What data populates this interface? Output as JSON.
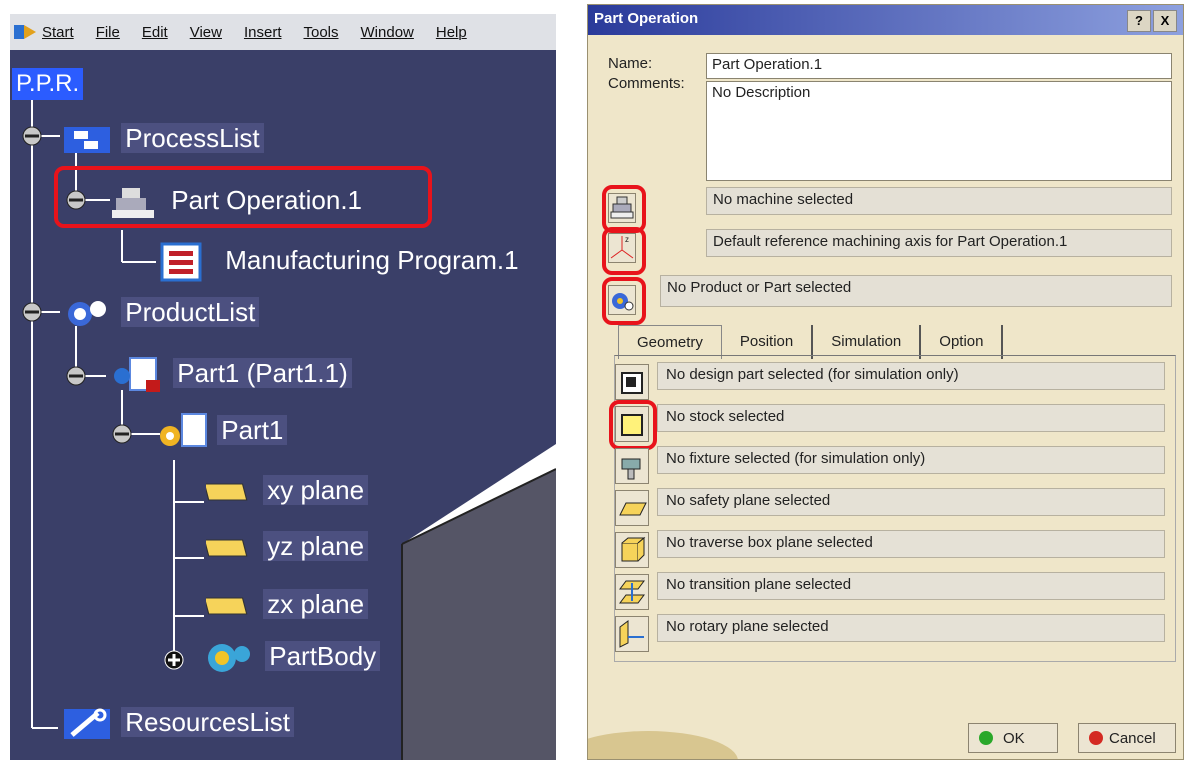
{
  "menubar": {
    "start": "Start",
    "items": [
      "File",
      "Edit",
      "View",
      "Insert",
      "Tools",
      "Window",
      "Help"
    ]
  },
  "tree": {
    "root": "P.P.R.",
    "process_list": "ProcessList",
    "part_operation": "Part Operation.1",
    "manufacturing_program": "Manufacturing Program.1",
    "product_list": "ProductList",
    "part1_instance": "Part1 (Part1.1)",
    "part1": "Part1",
    "xy_plane": "xy plane",
    "yz_plane": "yz plane",
    "zx_plane": "zx plane",
    "part_body": "PartBody",
    "resources_list": "ResourcesList"
  },
  "dialog": {
    "title": "Part Operation",
    "help_btn": "?",
    "close_btn": "X",
    "name_label": "Name:",
    "name_value": "Part Operation.1",
    "comments_label": "Comments:",
    "comments_value": "No Description",
    "machine": "No machine selected",
    "axis": "Default reference machining axis for Part Operation.1",
    "product": "No Product or Part selected",
    "tabs": [
      "Geometry",
      "Position",
      "Simulation",
      "Option"
    ],
    "geometry": [
      "No design part selected (for simulation only)",
      "No stock selected",
      "No fixture selected (for simulation only)",
      "No safety plane selected",
      "No traverse box plane selected",
      "No transition plane selected",
      "No rotary plane selected"
    ],
    "ok": "OK",
    "cancel": "Cancel"
  },
  "colors": {
    "highlight": "#e8131b",
    "tree_bg": "#3a3f68",
    "dialog_bg": "#efe6c9"
  }
}
